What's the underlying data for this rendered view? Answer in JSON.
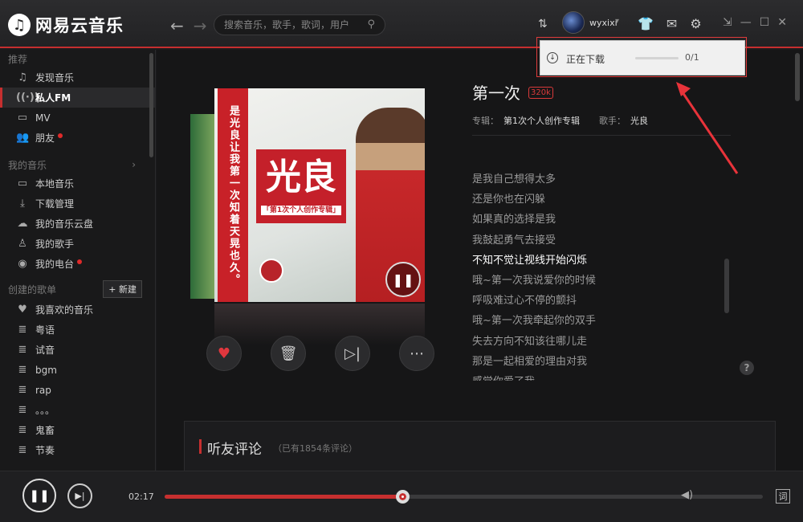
{
  "header": {
    "brand": "网易云音乐",
    "search_placeholder": "搜索音乐，歌手，歌词，用户",
    "username": "wyxixi"
  },
  "download_popup": {
    "label": "正在下载",
    "progress": 0.0,
    "count": "0/1"
  },
  "sidebar": {
    "sections": {
      "recommend": "推荐",
      "my_music": "我的音乐",
      "created": "创建的歌单"
    },
    "new_playlist": "+ 新建",
    "recommend_items": [
      "发现音乐",
      "私人FM",
      "MV",
      "朋友"
    ],
    "my_music_items": [
      "本地音乐",
      "下载管理",
      "我的音乐云盘",
      "我的歌手",
      "我的电台"
    ],
    "playlist_items": [
      "我喜欢的音乐",
      "粤语",
      "试音",
      "bgm",
      "rap",
      "。。。",
      "鬼畜",
      "节奏"
    ]
  },
  "song": {
    "title": "第一次",
    "bitrate": "320k",
    "album_label": "专辑：",
    "album": "第1次个人创作专辑",
    "artist_label": "歌手：",
    "artist": "光良"
  },
  "cover": {
    "vertical_text": "是光良让我第一次知着天晃也久。",
    "name": "光良",
    "sub": "「第1次个人创作专辑」"
  },
  "lyrics": {
    "current_index": 4,
    "lines": [
      "是我自己想得太多",
      "还是你也在闪躲",
      "如果真的选择是我",
      "我鼓起勇气去接受",
      "不知不觉让视线开始闪烁",
      "哦~第一次我说爱你的时候",
      "呼吸难过心不停的颤抖",
      "哦~第一次我牵起你的双手",
      "失去方向不知该往哪儿走",
      "那是一起相爱的理由对我",
      "感觉你爱了我"
    ]
  },
  "comments": {
    "heading": "听友评论",
    "count": "（已有1854条评论）"
  },
  "player": {
    "current_time": "02:17",
    "progress": 0.397
  },
  "colors": {
    "accent": "#c62f2f",
    "background": "#161617"
  }
}
